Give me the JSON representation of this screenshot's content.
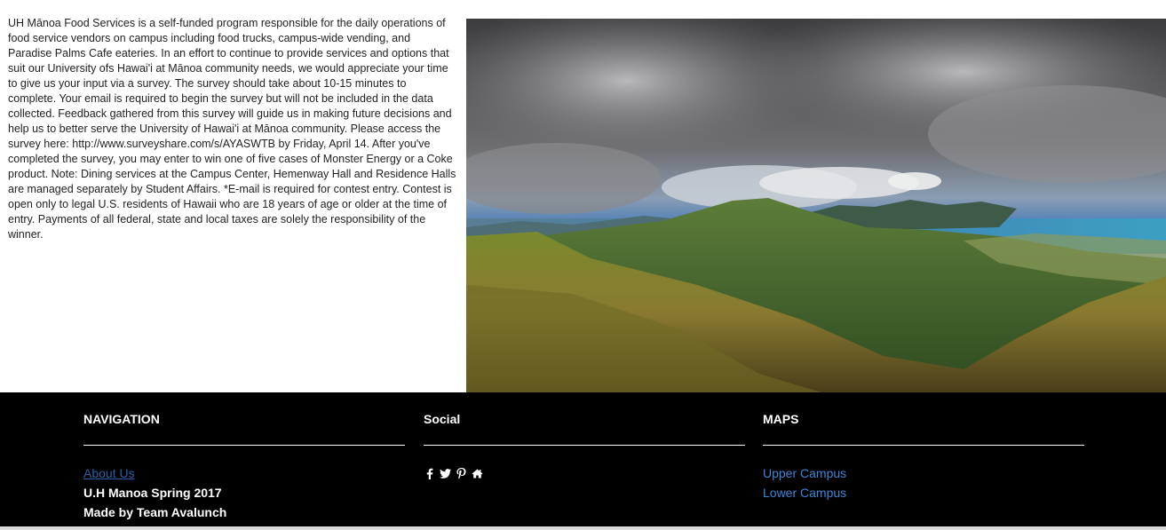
{
  "announcement": {
    "text": "UH Mānoa Food Services is a self-funded program responsible for the daily operations of food service vendors on campus including food trucks, campus-wide vending, and Paradise Palms Cafe eateries. In an effort to continue to provide services and options that suit our University ofs Hawai'i at Mānoa community needs, we would appreciate your time to give us your input via a survey. The survey should take about 10-15 minutes to complete. Your email is required to begin the survey but will not be included in the data collected. Feedback gathered from this survey will guide us in making future decisions and help us to better serve the University of Hawai'i at Mānoa community. Please access the survey here: http://www.surveyshare.com/s/AYASWTB by Friday, April 14. After you've completed the survey, you may enter to win one of five cases of Monster Energy or a Coke product. Note: Dining services at the Campus Center, Hemenway Hall and Residence Halls are managed separately by Student Affairs. *E-mail is required for contest entry. Contest is open only to legal U.S. residents of Hawaii who are 18 years of age or older at the time of entry. Payments of all federal, state and local taxes are solely the responsibility of the winner."
  },
  "footer": {
    "navigation": {
      "heading": "NAVIGATION",
      "about_link": "About Us",
      "line1": "U.H Manoa Spring 2017",
      "line2": "Made by Team Avalunch"
    },
    "social": {
      "heading": "Social",
      "icons": [
        "facebook-icon",
        "twitter-icon",
        "pinterest-icon",
        "home-icon"
      ]
    },
    "maps": {
      "heading": "MAPS",
      "links": [
        "Upper Campus",
        "Lower Campus"
      ]
    }
  },
  "colors": {
    "footer_bg": "#000000",
    "link_blue": "#3e86d6",
    "about_link": "#2c5fa8"
  }
}
